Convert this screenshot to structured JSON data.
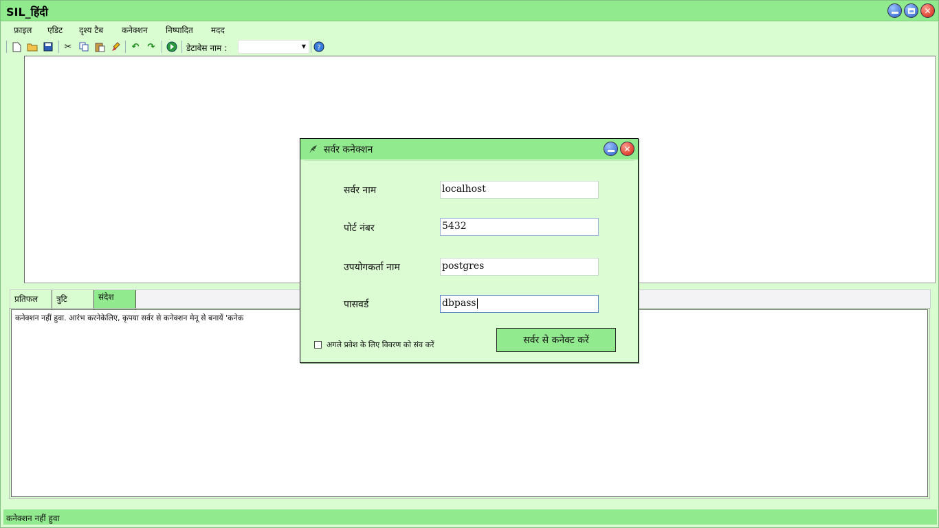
{
  "window": {
    "title": "SIL_हिंदी"
  },
  "menu": [
    "फ़ाइल",
    "एडिट",
    "दृश्य टैब",
    "कनेक्शन",
    "निष्पादित",
    "मदद"
  ],
  "toolbar": {
    "db_label": "डेटाबेस नाम :",
    "db_value": "",
    "icons": [
      "new-file-icon",
      "open-folder-icon",
      "save-icon",
      "cut-icon",
      "copy-icon",
      "paste-icon",
      "clear-icon",
      "undo-icon",
      "redo-icon",
      "execute-icon",
      "help-icon"
    ]
  },
  "tabs": [
    {
      "label": "प्रतिफल",
      "active": false
    },
    {
      "label": "त्रुटि",
      "active": false
    },
    {
      "label": "संदेश",
      "active": true
    }
  ],
  "output": {
    "message": "कनेक्शन नहीं हुवा. आरंभ करनेकेलिए, कृपया सर्वर से कनेक्शन मेनू से बनायें  'कनेक"
  },
  "status": {
    "text": "कनेक्शन नहीं हुवा"
  },
  "dialog": {
    "title": "सर्वर कनेक्शन",
    "fields": [
      {
        "label": "सर्वर नाम",
        "value": "localhost"
      },
      {
        "label": "पोर्ट नंबर",
        "value": "5432"
      },
      {
        "label": "उपयोगकर्ता नाम",
        "value": "postgres"
      },
      {
        "label": "पासवर्ड",
        "value": "dbpass"
      }
    ],
    "remember_label": "अगले प्रवेश के लिए विवरण को संव करें",
    "remember_checked": false,
    "connect_label": "सर्वर से कनेक्ट करें"
  },
  "colors": {
    "bar_green": "#92ea8f",
    "bg_green": "#d9fcd0",
    "close_red": "#d21c0c",
    "min_blue": "#2a5cc4"
  }
}
